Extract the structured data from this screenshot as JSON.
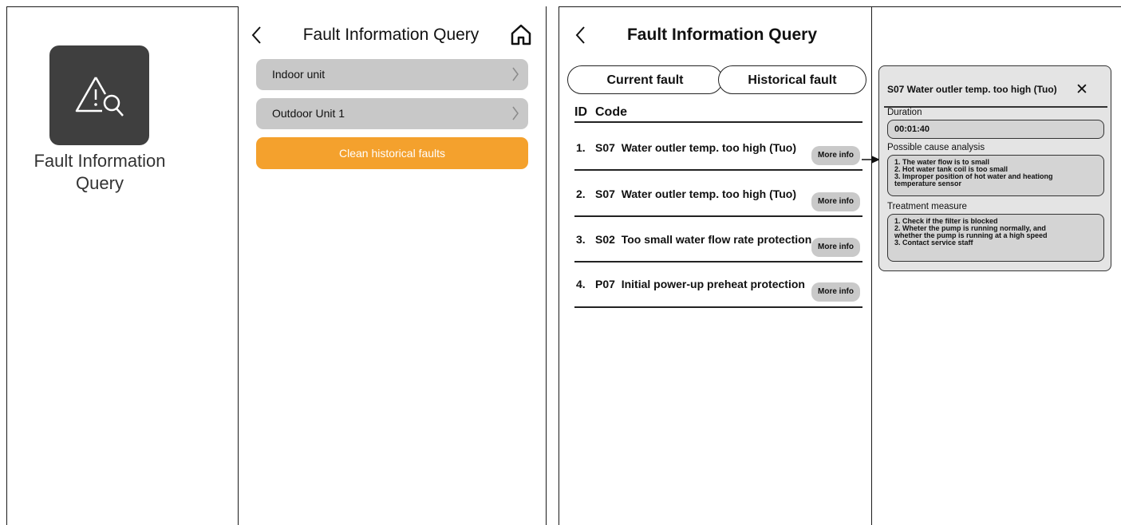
{
  "panel1": {
    "label_line1": "Fault Information",
    "label_line2": "Query"
  },
  "panel2": {
    "title": "Fault Information Query",
    "items": [
      {
        "label": "Indoor unit"
      },
      {
        "label": "Outdoor Unit 1"
      }
    ],
    "clean_label": "Clean historical faults",
    "clean_color": "#f4a12d"
  },
  "panel3": {
    "title": "Fault Information Query",
    "tabs": [
      "Current fault",
      "Historical fault"
    ],
    "header": {
      "id": "ID",
      "code": "Code"
    },
    "faults": [
      {
        "num": "1.",
        "code": "S07",
        "desc": "Water outler temp. too high (Tuo)",
        "btn": "More info"
      },
      {
        "num": "2.",
        "code": "S07",
        "desc": "Water outler temp. too high (Tuo)",
        "btn": "More info"
      },
      {
        "num": "3.",
        "code": "S02",
        "desc": "Too small water flow rate protection",
        "btn": "More info"
      },
      {
        "num": "4.",
        "code": "P07",
        "desc": "Initial power-up preheat protection",
        "btn": "More info"
      }
    ]
  },
  "popup": {
    "title": "S07  Water outler temp. too high (Tuo)",
    "duration_label": "Duration",
    "duration_value": "00:01:40",
    "cause_label": "Possible cause analysis",
    "causes": [
      "1. The water flow is to small",
      "2. Hot water tank coil is too small",
      "3. Improper position of hot water and heationg",
      "temperature sensor"
    ],
    "measure_label": "Treatment measure",
    "measures": [
      "1. Check if the filter is blocked",
      "2. Wheter the pump is running normally, and",
      "whether the pump is running at a high speed",
      "3. Contact service staff"
    ]
  }
}
